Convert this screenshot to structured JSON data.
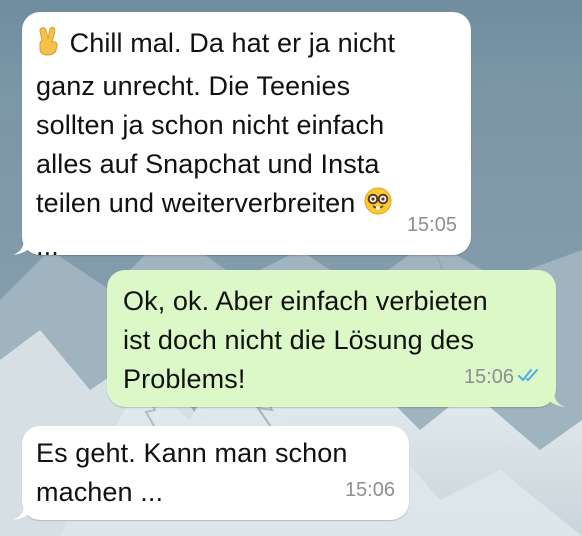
{
  "chat": {
    "messages": [
      {
        "direction": "incoming",
        "leading_icon": "victory-hand-emoji",
        "lines": [
          "Chill mal. Da hat er ja nicht",
          "ganz unrecht. Die Teenies",
          "sollten ja schon nicht einfach",
          "alles auf Snapchat und Insta",
          "teilen und weiterverbreiten",
          "..."
        ],
        "trailing_icon": "nerd-face-emoji",
        "time": "15:05"
      },
      {
        "direction": "outgoing",
        "lines": [
          "Ok, ok. Aber einfach verbieten",
          "ist doch nicht die Lösung des",
          "Problems!"
        ],
        "time": "15:06",
        "status_icon": "double-check-read-icon",
        "status_color": "#4fa9e8"
      },
      {
        "direction": "incoming",
        "lines": [
          "Es geht. Kann man schon",
          "machen ..."
        ],
        "time": "15:06"
      }
    ]
  },
  "colors": {
    "incoming_bubble": "#ffffff",
    "outgoing_bubble": "#dcf8c6",
    "timestamp": "#8e8e93"
  }
}
